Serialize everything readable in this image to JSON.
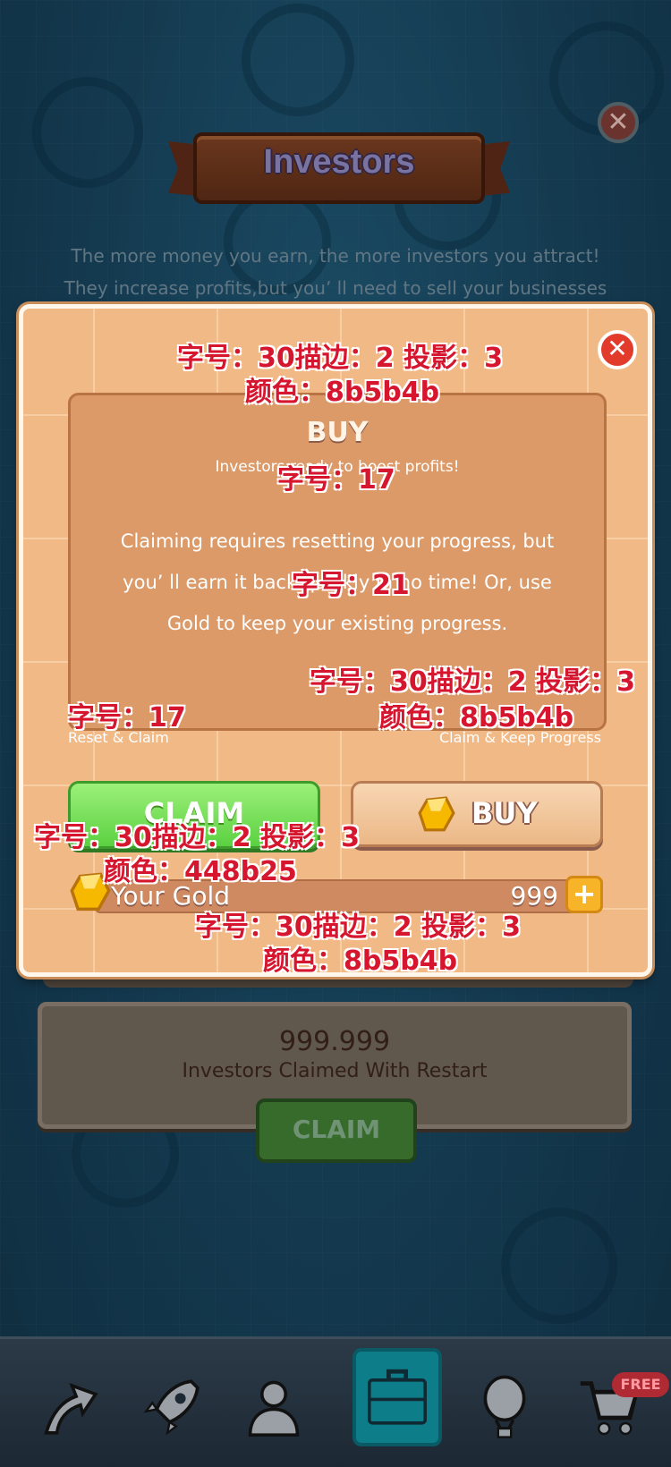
{
  "header": {
    "title": "Investors"
  },
  "description": "The more money you earn, the more investors you attract! They increase profits,but youʼ ll need to sell your businesses and start",
  "modal": {
    "title": "BUY",
    "subtitle": "Investors ready to boost profits!",
    "body": "Claiming requires resetting your progress, but youʼ ll earn it back quickly in no time! Or, use Gold to keep your existing progress.",
    "claim_caption": "Reset & Claim",
    "buy_caption": "Claim & Keep Progress",
    "claim_button": "CLAIM",
    "buy_button": "BUY",
    "gold_label": "Your Gold",
    "gold_value": "999",
    "plus_symbol": "+",
    "close_symbol": "✕"
  },
  "annotations": {
    "title_spec_1": "字号：30描边：2 投影：3",
    "title_spec_2": "颜色：8b5b4b",
    "subtitle_spec": "字号：17",
    "body_spec": "字号：21",
    "buy_spec_1": "字号：30描边：2 投影：3",
    "buy_spec_2": "颜色：8b5b4b",
    "caption_spec": "字号：17",
    "claim_spec_1": "字号：30描边：2 投影：3",
    "claim_spec_2": "颜色：448b25",
    "gold_spec_1": "字号：30描边：2 投影：3",
    "gold_spec_2": "颜色：8b5b4b"
  },
  "background_card": {
    "value": "999.999",
    "label": "Investors Claimed With Restart",
    "claim_button": "CLAIM"
  },
  "nav": {
    "items": [
      {
        "icon": "arrow-up-icon"
      },
      {
        "icon": "rocket-icon"
      },
      {
        "icon": "manager-icon"
      },
      {
        "icon": "briefcase-icon"
      },
      {
        "icon": "balloon-icon"
      },
      {
        "icon": "cart-icon"
      }
    ],
    "free_badge": "FREE",
    "active_index": 3
  },
  "colors": {
    "stroke_brown": "#8b5b4b",
    "stroke_green": "#448b25",
    "panel": "#f1b985",
    "annotation_red": "#d6152e"
  }
}
